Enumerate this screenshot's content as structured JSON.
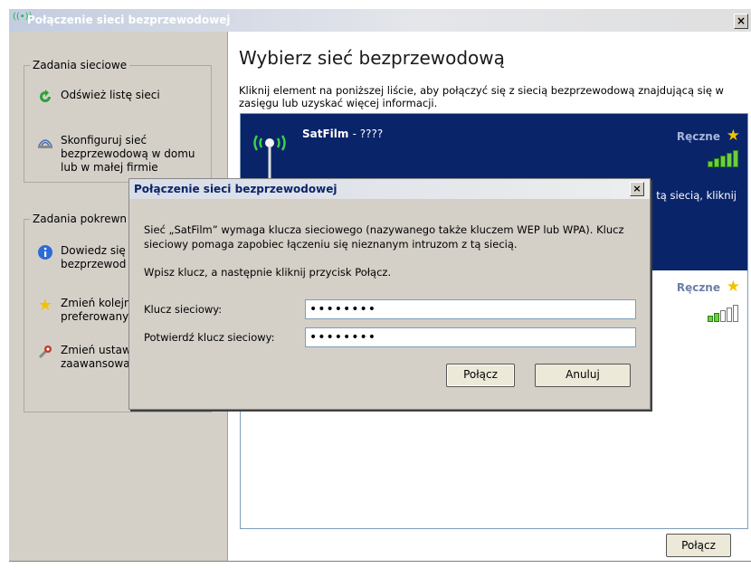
{
  "window": {
    "title": "Połączenie sieci bezprzewodowej",
    "close": "×"
  },
  "left_panel": {
    "network_tasks": {
      "legend": "Zadania sieciowe",
      "items": [
        {
          "label": "Odśwież listę sieci",
          "icon": "refresh-icon"
        },
        {
          "label": "Skonfiguruj sieć bezprzewodową w domu lub w małej firmie",
          "icon": "wireless-setup-icon"
        }
      ]
    },
    "related_tasks": {
      "legend": "Zadania pokrewn",
      "items": [
        {
          "label": "Dowiedz się bezprzewod",
          "icon": "info-icon"
        },
        {
          "label": "Zmień kolejn preferowany",
          "icon": "star-icon"
        },
        {
          "label": "Zmień ustaw zaawansowa",
          "icon": "settings-icon"
        }
      ]
    }
  },
  "main": {
    "heading": "Wybierz sieć bezprzewodową",
    "instruction": "Kliknij element na poniższej liście, aby połączyć się z siecią bezprzewodową znajdującą się w zasięgu lub uzyskać więcej informacji.",
    "networks": [
      {
        "name": "SatFilm",
        "suffix": "- ????",
        "mode": "Ręczne",
        "partial_text": "tą siecią, kliknij",
        "signal_bars": 5
      },
      {
        "mode": "Ręczne",
        "signal_bars": 2
      }
    ],
    "connect_button": "Połącz"
  },
  "dialog": {
    "title": "Połączenie sieci bezprzewodowej",
    "close": "×",
    "message": "Sieć „SatFilm” wymaga klucza sieciowego (nazywanego także kluczem WEP lub WPA). Klucz sieciowy pomaga zapobiec łączeniu się nieznanym intruzom z tą siecią.",
    "prompt": "Wpisz klucz, a następnie kliknij przycisk Połącz.",
    "key_label": "Klucz sieciowy:",
    "key_value": "••••••••",
    "confirm_label": "Potwierdź klucz sieciowy:",
    "confirm_value": "••••••••",
    "connect": "Połącz",
    "cancel": "Anuluj"
  },
  "colors": {
    "selected_bg": "#0a246a",
    "star": "#f2c200",
    "signal_green": "#6bd03a"
  }
}
